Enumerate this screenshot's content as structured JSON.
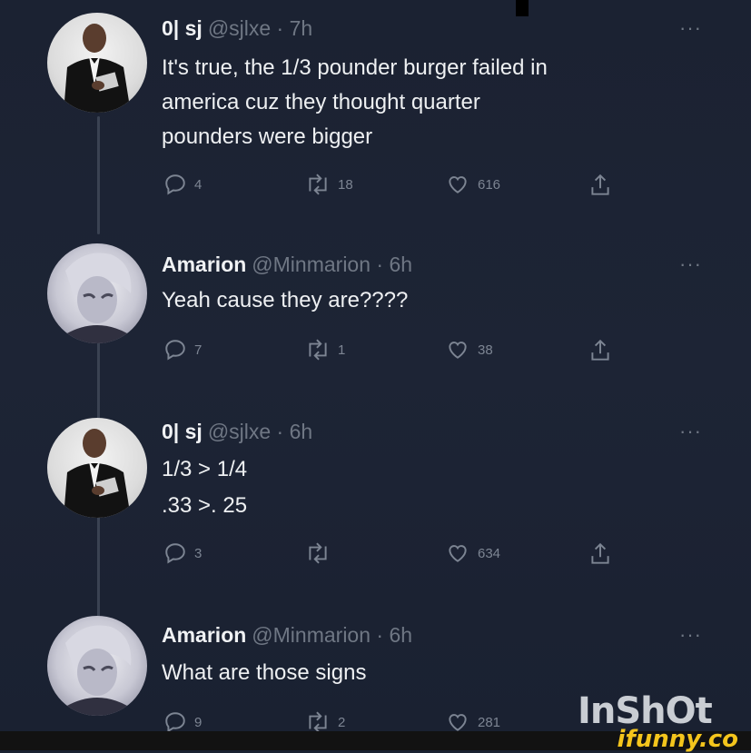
{
  "tweets": [
    {
      "name": "0| sj",
      "handle": "@sjlxe · 7h",
      "more": "···",
      "lines": [
        "It's true, the 1/3 pounder burger failed in",
        "america cuz they thought quarter",
        "pounders were bigger"
      ],
      "replies": "4",
      "retweets": "18",
      "likes": "616"
    },
    {
      "name": "Amarion",
      "handle": "@Minmarion · 6h",
      "more": "···",
      "lines": [
        "Yeah cause they are????"
      ],
      "replies": "7",
      "retweets": "1",
      "likes": "38"
    },
    {
      "name": "0| sj",
      "handle": "@sjlxe · 6h",
      "more": "···",
      "lines": [
        "1/3 > 1/4",
        ".33 >. 25"
      ],
      "replies": "3",
      "retweets": "",
      "likes": "634"
    },
    {
      "name": "Amarion",
      "handle": "@Minmarion · 6h",
      "more": "···",
      "lines": [
        "What are those signs"
      ],
      "replies": "9",
      "retweets": "2",
      "likes": "281"
    }
  ],
  "watermarks": {
    "inshot": "InShOt",
    "ifunny": "ifunny.co"
  },
  "colors": {
    "background": "#1b2232",
    "text": "#e7e9ea",
    "muted": "#6f7784",
    "ifunny": "#f4c51c"
  }
}
